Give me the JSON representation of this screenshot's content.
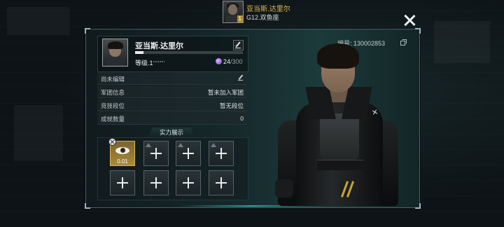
{
  "header": {
    "player_name": "亚当斯.达里尔",
    "zodiac": "G12.双鱼座",
    "avatar_badge": "1"
  },
  "panel": {
    "id_label": "编号: 130002853"
  },
  "profile": {
    "name": "亚当斯.达里尔",
    "level": "等级.1",
    "exp_fraction": 0.08,
    "energy_current": "24",
    "energy_max": "/300"
  },
  "info_rows": [
    {
      "label": "尚未编辑",
      "value": ""
    },
    {
      "label": "军团信息",
      "value": "暂未加入军团"
    },
    {
      "label": "竞技段位",
      "value": "暂无段位"
    },
    {
      "label": "成就数量",
      "value": "0"
    }
  ],
  "showcase": {
    "title": "实力展示",
    "featured_value": "0.01"
  },
  "colors": {
    "gold_accent": "#e2b64a",
    "energy_purple": "#9b59f0",
    "panel_teal": "#1c3a3b"
  },
  "icons": {
    "close": "close-icon",
    "edit": "pencil-icon",
    "copy": "copy-icon",
    "add": "plus-icon",
    "energy": "energy-orb-icon",
    "eye": "eye-icon"
  }
}
